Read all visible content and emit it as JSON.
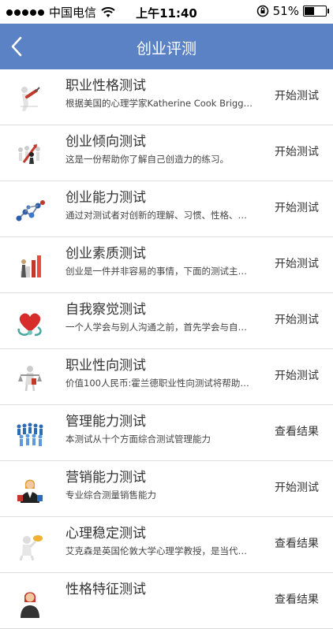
{
  "status_bar": {
    "carrier": "中国电信",
    "time": "上午11:40",
    "battery_percent": "51%",
    "battery_level": 0.51
  },
  "nav": {
    "title": "创业评测"
  },
  "items": [
    {
      "title": "职业性格测试",
      "desc": "根据美国的心理学家Katherine Cook Briggs…",
      "action": "开始测试",
      "icon": "person-pen-icon"
    },
    {
      "title": "创业倾向测试",
      "desc": "这是一份帮助你了解自己创造力的练习。",
      "action": "开始测试",
      "icon": "figures-arrow-icon"
    },
    {
      "title": "创业能力测试",
      "desc": "通过对测试者对创新的理解、习惯、性格、…",
      "action": "开始测试",
      "icon": "network-icon"
    },
    {
      "title": "创业素质测试",
      "desc": "创业是一件并非容易的事情，下面的测试主…",
      "action": "开始测试",
      "icon": "bar-chart-icon"
    },
    {
      "title": "自我察觉测试",
      "desc": "一个人学会与别人沟通之前，首先学会与自…",
      "action": "开始测试",
      "icon": "heart-stethoscope-icon"
    },
    {
      "title": "职业性向测试",
      "desc": "价值100人民币:霍兰德职业性向测试将帮助…",
      "action": "开始测试",
      "icon": "justice-scale-icon"
    },
    {
      "title": "管理能力测试",
      "desc": "本测试从十个方面综合测试管理能力",
      "action": "查看结果",
      "icon": "crowd-icon"
    },
    {
      "title": "营销能力测试",
      "desc": "专业综合测量销售能力",
      "action": "开始测试",
      "icon": "businesswoman-icon"
    },
    {
      "title": "心理稳定测试",
      "desc": "艾克森是英国伦敦大学心理学教授，是当代…",
      "action": "查看结果",
      "icon": "thinking-figure-icon"
    },
    {
      "title": "性格特征测试",
      "desc": "",
      "action": "查看结果",
      "icon": "person-portrait-icon"
    }
  ]
}
